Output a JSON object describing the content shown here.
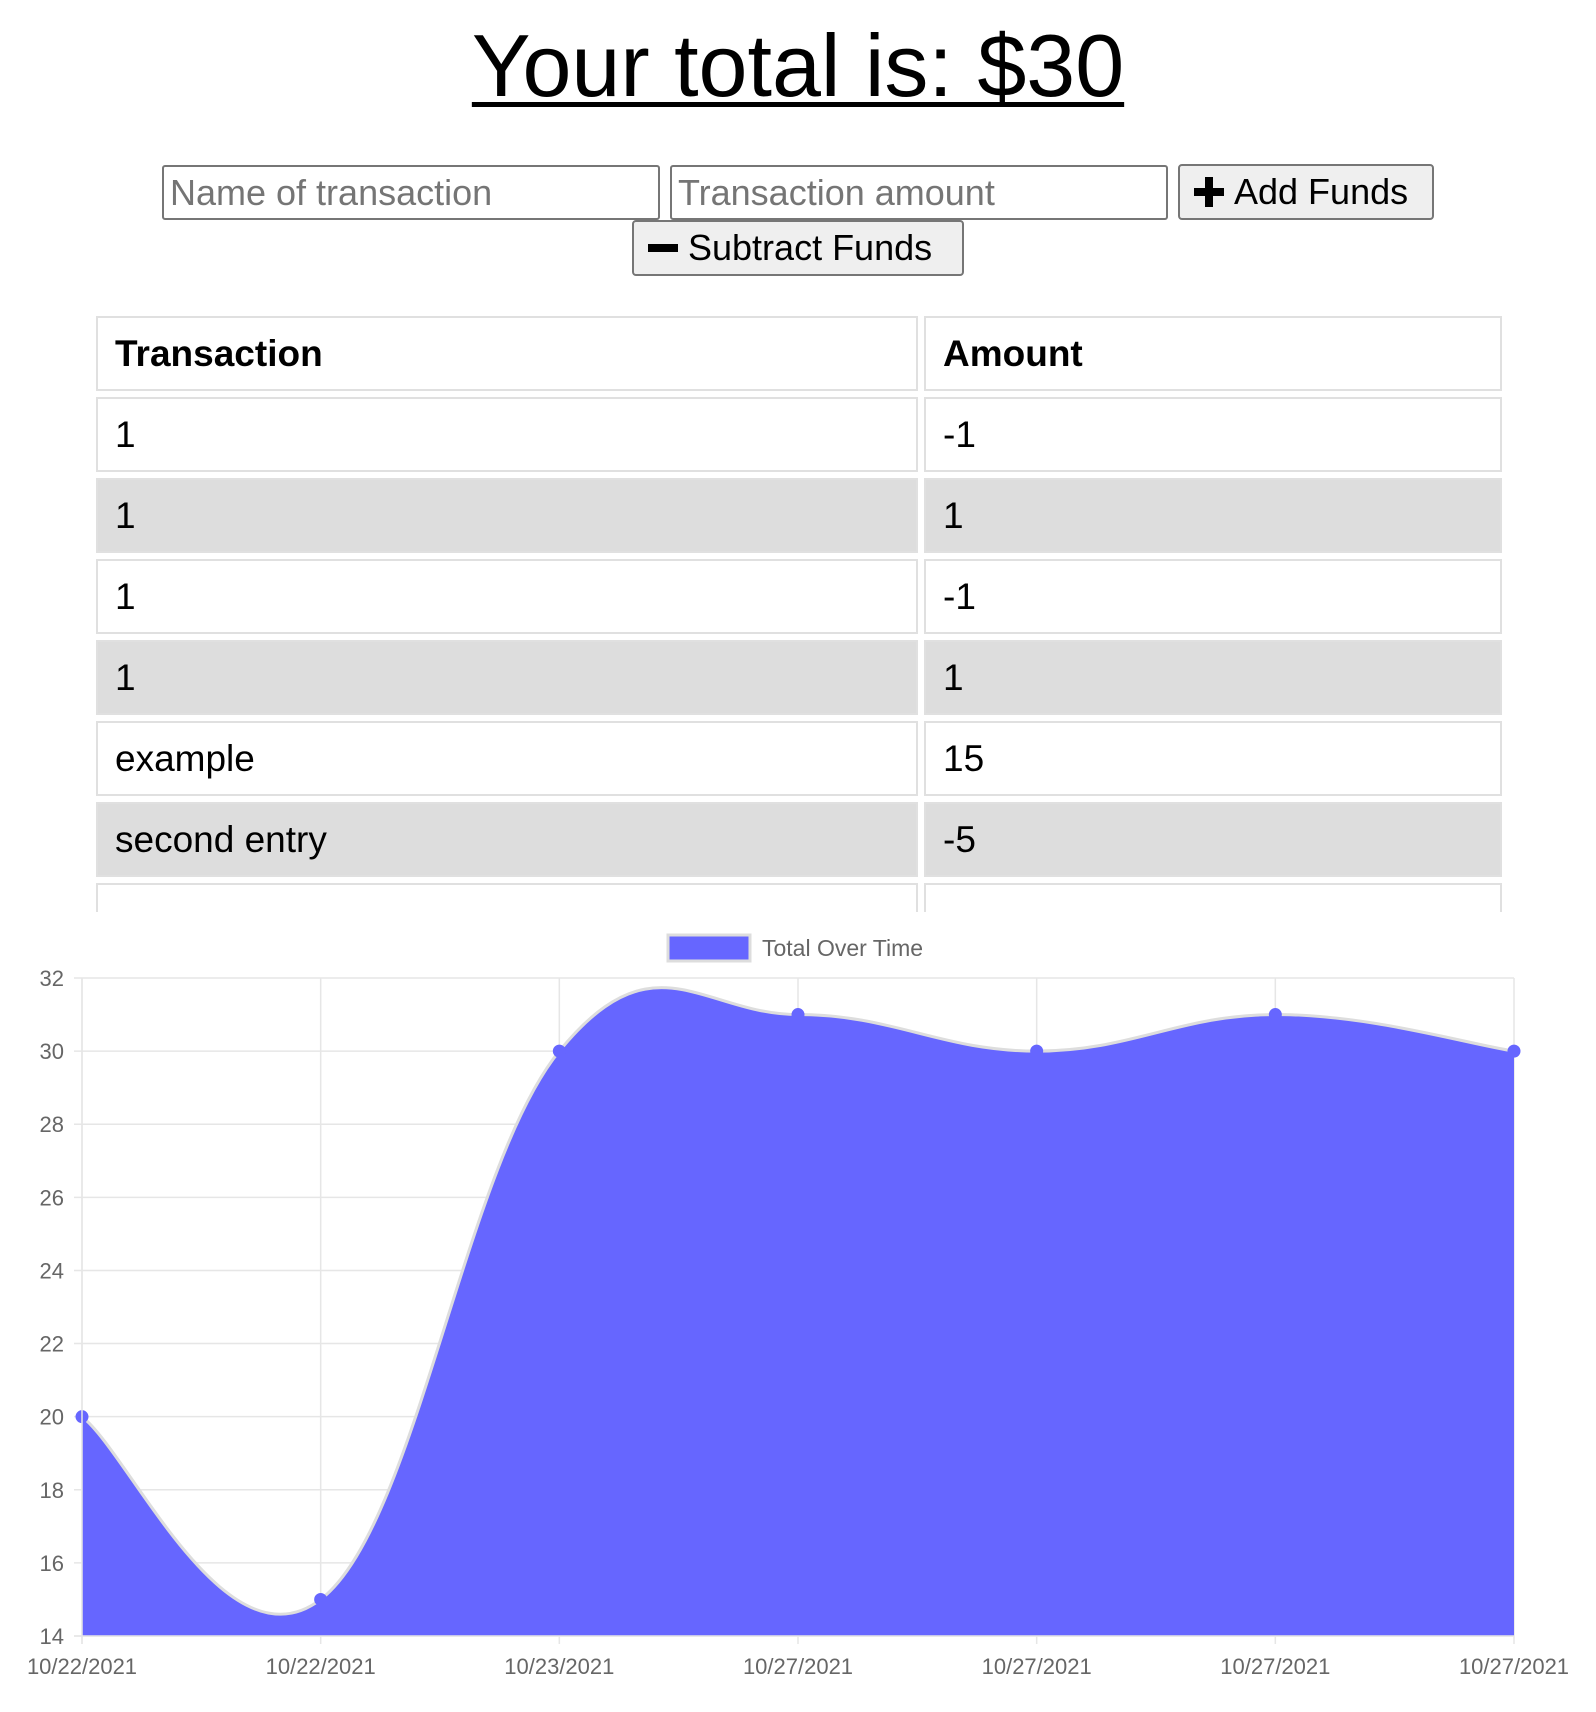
{
  "header": {
    "title": "Your total is: $30"
  },
  "form": {
    "name_placeholder": "Name of transaction",
    "amount_placeholder": "Transaction amount",
    "add_label": "Add Funds",
    "subtract_label": "Subtract Funds"
  },
  "table": {
    "headers": [
      "Transaction",
      "Amount"
    ],
    "rows": [
      {
        "name": "1",
        "amount": "-1"
      },
      {
        "name": "1",
        "amount": "1"
      },
      {
        "name": "1",
        "amount": "-1"
      },
      {
        "name": "1",
        "amount": "1"
      },
      {
        "name": "example",
        "amount": "15"
      },
      {
        "name": "second entry",
        "amount": "-5"
      },
      {
        "name": "",
        "amount": ""
      }
    ]
  },
  "colors": {
    "fill": "#6666ff",
    "line": "#dddddd",
    "grid": "#e6e6e6",
    "tick_text": "#666666"
  },
  "chart_data": {
    "type": "area",
    "legend": [
      "Total Over Time"
    ],
    "legend_position": "top-center",
    "grid": true,
    "categories": [
      "10/22/2021",
      "10/22/2021",
      "10/23/2021",
      "10/27/2021",
      "10/27/2021",
      "10/27/2021",
      "10/27/2021"
    ],
    "series": [
      {
        "name": "Total Over Time",
        "values": [
          20,
          15,
          30,
          31,
          30,
          31,
          30
        ]
      }
    ],
    "ylim": [
      14,
      32
    ],
    "yticks": [
      "14",
      "16",
      "18",
      "20",
      "22",
      "24",
      "26",
      "28",
      "30",
      "32"
    ]
  }
}
